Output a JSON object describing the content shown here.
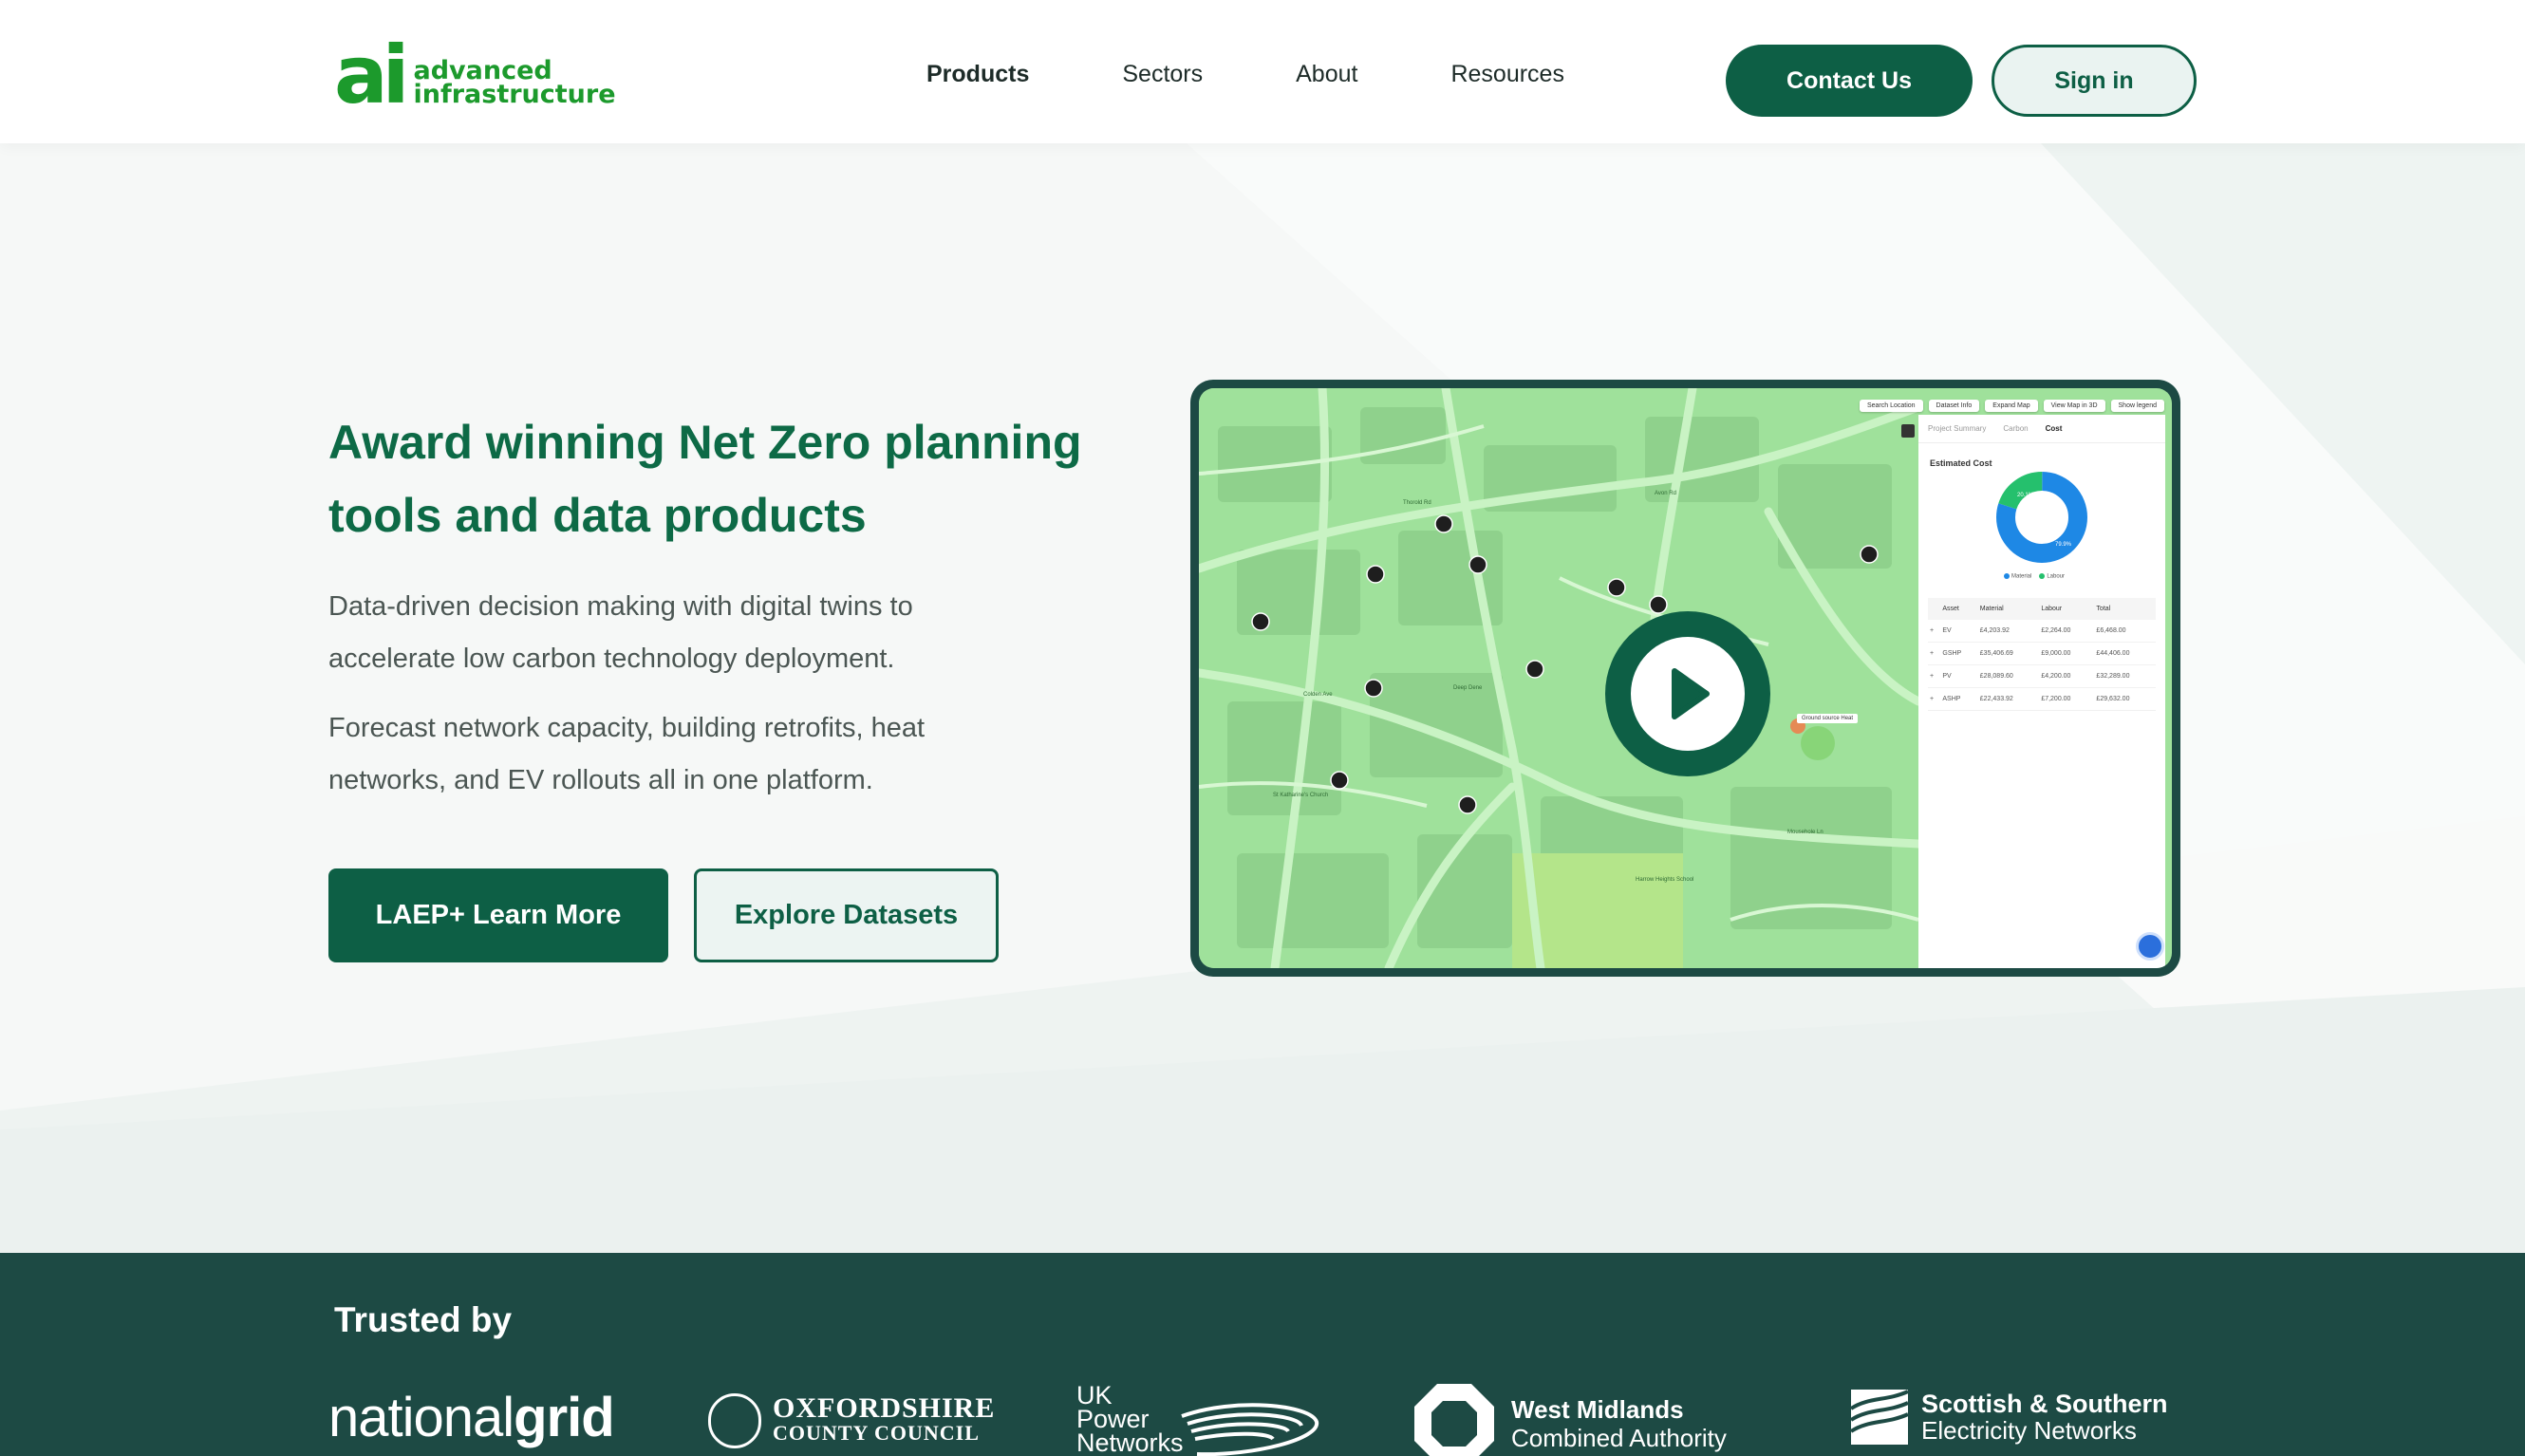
{
  "header": {
    "logo_mark": "ai",
    "logo_line1": "advanced",
    "logo_line2": "infrastructure",
    "nav": [
      {
        "label": "Products",
        "active": true
      },
      {
        "label": "Sectors",
        "active": false
      },
      {
        "label": "About",
        "active": false
      },
      {
        "label": "Resources",
        "active": false
      }
    ],
    "contact_label": "Contact Us",
    "signin_label": "Sign in"
  },
  "hero": {
    "title": "Award winning Net Zero planning tools and data products",
    "paragraph1": "Data-driven decision making with digital twins to accelerate low carbon technology deployment.",
    "paragraph2": "Forecast network capacity, building retrofits, heat networks, and EV rollouts all in one platform.",
    "learn_more_label": "LAEP+ Learn More",
    "explore_label": "Explore Datasets"
  },
  "preview": {
    "toolbar": [
      "Search Location",
      "Dataset Info",
      "Expand Map",
      "View Map in 3D",
      "Show legend"
    ],
    "tabs": [
      "Project Summary",
      "Carbon",
      "Cost"
    ],
    "active_tab": "Cost",
    "panel_heading": "Estimated Cost",
    "donut": {
      "slices": [
        {
          "label": "Material",
          "value": 79.9,
          "color": "#1e88e5"
        },
        {
          "label": "Labour",
          "value": 20.1,
          "color": "#25c06d"
        }
      ],
      "label_material": "79.9%",
      "label_labour": "20.1%"
    },
    "table_headers": [
      "Asset",
      "Material",
      "Labour",
      "Total"
    ],
    "table_rows": [
      [
        "EV",
        "£4,203.92",
        "£2,264.00",
        "£6,468.00"
      ],
      [
        "GSHP",
        "£35,406.69",
        "£9,000.00",
        "£44,406.00"
      ],
      [
        "PV",
        "£28,089.60",
        "£4,200.00",
        "£32,289.00"
      ],
      [
        "ASHP",
        "£22,433.92",
        "£7,200.00",
        "£29,632.00"
      ]
    ],
    "map_labels": [
      "Thorold Rd",
      "Deep Dene",
      "Colden Ave",
      "St Katharine's Church",
      "Mousehole Ln",
      "Harrow Heights School",
      "Avon Rd"
    ],
    "heat_tag": "Ground source Heat"
  },
  "trusted": {
    "title": "Trusted by",
    "national_grid_light": "national",
    "national_grid_bold": "grid",
    "occ_line1": "OXFORDSHIRE",
    "occ_line2": "COUNTY COUNCIL",
    "ukpn_lines": [
      "UK",
      "Power",
      "Networks"
    ],
    "wm_line1": "West Midlands",
    "wm_line2": "Combined Authority",
    "sse_line1": "Scottish & Southern",
    "sse_line2": "Electricity Networks"
  },
  "colors": {
    "brand_green": "#0d5f45",
    "logo_green": "#1c9a2c",
    "dark_band": "#1d4a44",
    "map_green": "#9fe19b"
  }
}
